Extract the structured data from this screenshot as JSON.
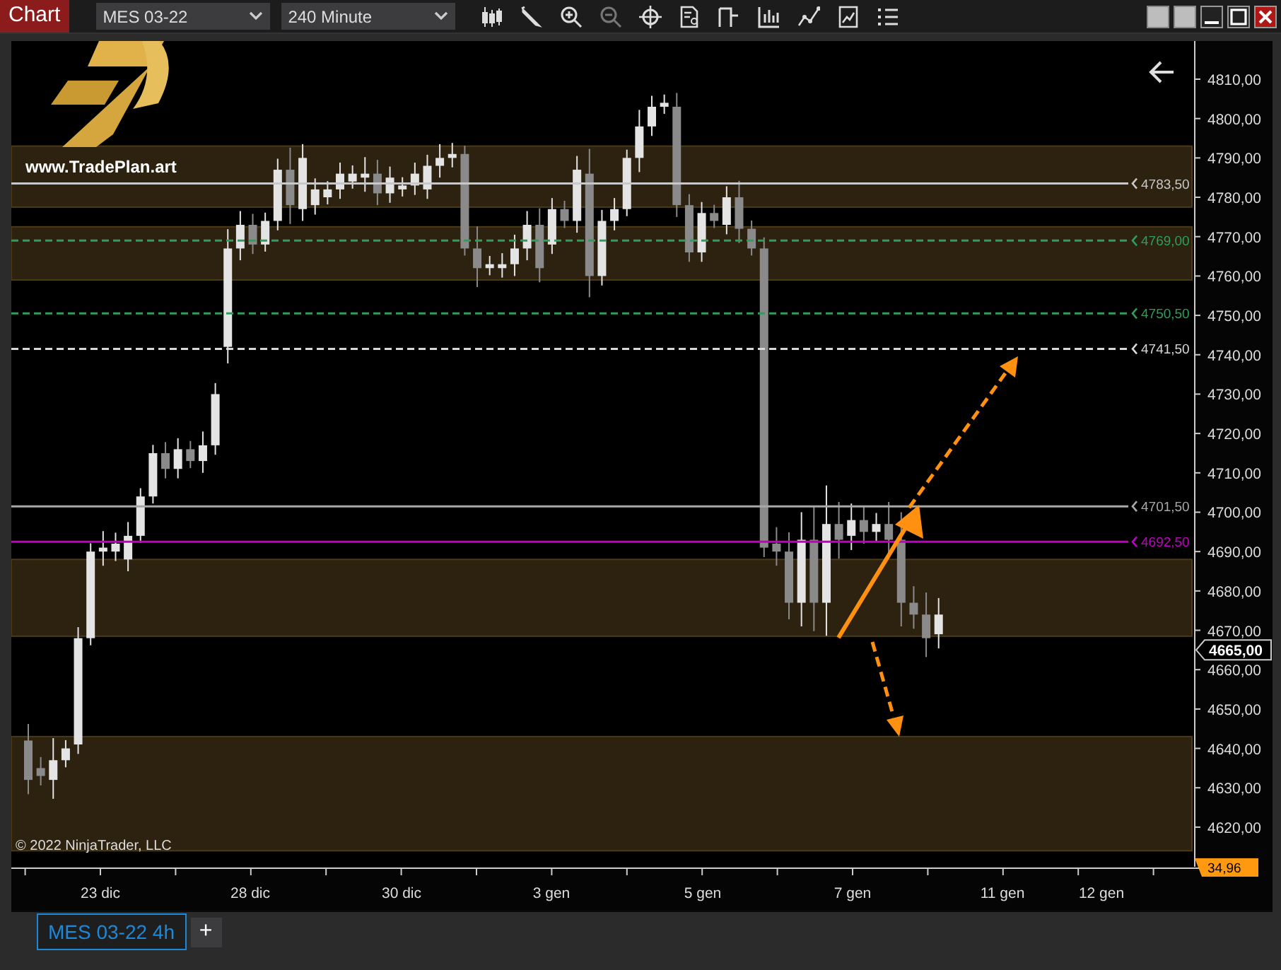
{
  "toolbar": {
    "title": "Chart",
    "instrument": "MES 03-22",
    "interval": "240 Minute"
  },
  "chart": {
    "logo_text": "www.TradePlan.art",
    "copyright": "© 2022 NinjaTrader, LLC",
    "price_ticks": [
      "4810,00",
      "4800,00",
      "4790,00",
      "4780,00",
      "4770,00",
      "4760,00",
      "4750,00",
      "4740,00",
      "4730,00",
      "4720,00",
      "4710,00",
      "4700,00",
      "4690,00",
      "4680,00",
      "4670,00",
      "4660,00",
      "4650,00",
      "4640,00",
      "4630,00",
      "4620,00"
    ],
    "date_labels": [
      "23 dic",
      "28 dic",
      "30 dic",
      "3 gen",
      "5 gen",
      "7 gen",
      "11 gen",
      "12 gen"
    ],
    "levels": [
      {
        "label": "4783,50",
        "color": "#c8c8c8",
        "kind": "solid"
      },
      {
        "label": "4769,00",
        "color": "#2e9e5a",
        "kind": "dashed"
      },
      {
        "label": "4750,50",
        "color": "#2e9e5a",
        "kind": "dashed"
      },
      {
        "label": "4741,50",
        "color": "#d8d8d8",
        "kind": "dashed"
      },
      {
        "label": "4701,50",
        "color": "#a8a8a8",
        "kind": "solid"
      },
      {
        "label": "4692,50",
        "color": "#c000c0",
        "kind": "solid"
      }
    ],
    "last_price": "4665,00",
    "indicator_value": "34,96"
  },
  "tabs": [
    {
      "label": "MES 03-22 4h",
      "selected": true
    }
  ],
  "add_tab": "+"
}
